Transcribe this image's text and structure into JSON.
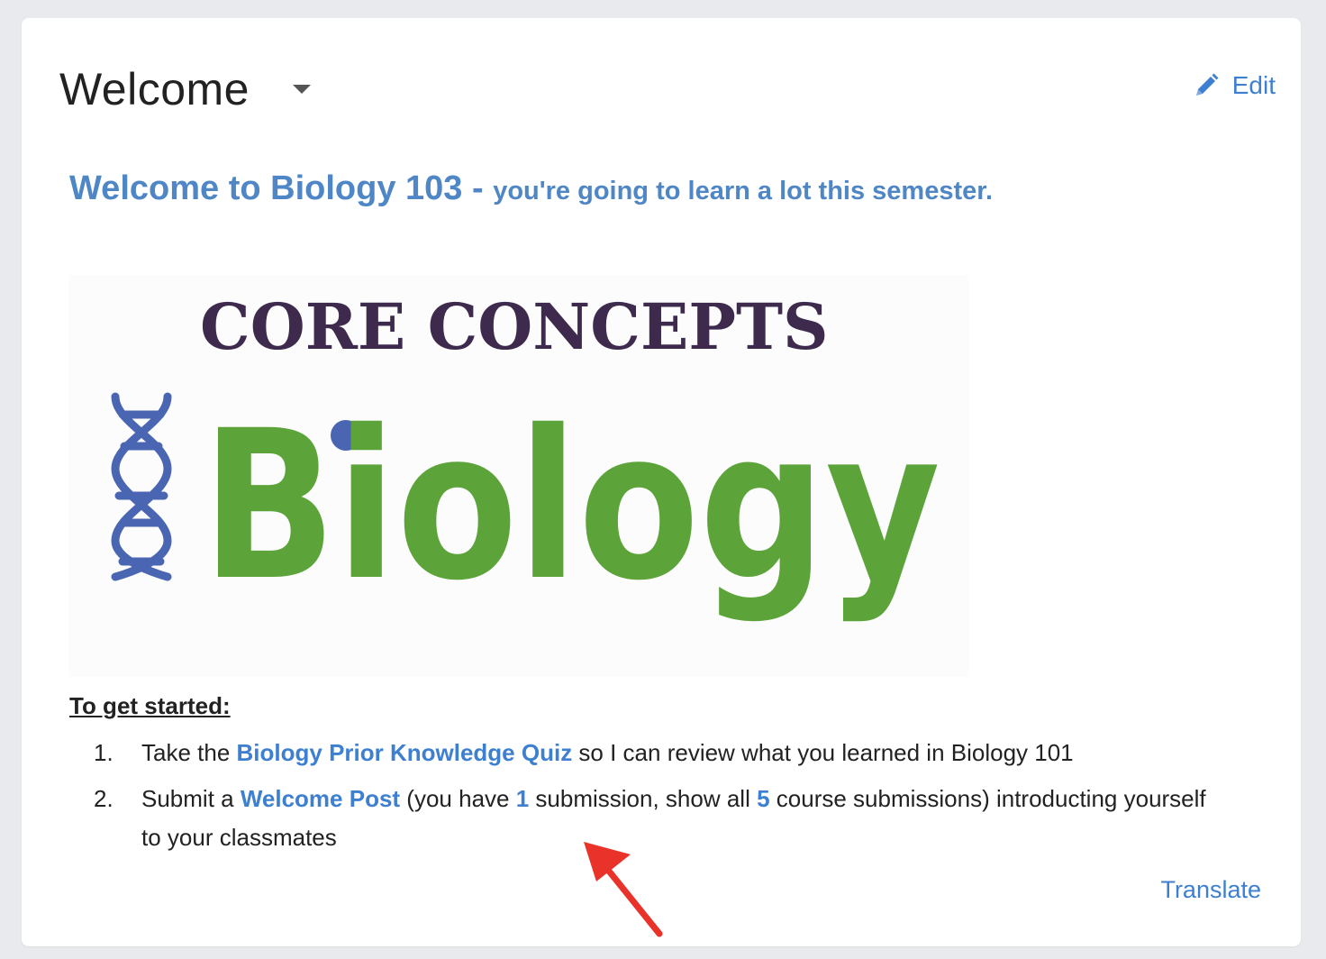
{
  "header": {
    "title": "Welcome",
    "edit_label": "Edit"
  },
  "content": {
    "headline_main": "Welcome to Biology 103 - ",
    "headline_sub": "you're going to learn a lot this semester.",
    "logo": {
      "top_text": "CORE CONCEPTS",
      "main_text": "Biology"
    },
    "getting_started": "To get started:",
    "steps": [
      {
        "num": "1.",
        "prefix": "Take the ",
        "link": "Biology Prior Knowledge Quiz",
        "suffix": " so I can review what you learned in Biology 101"
      },
      {
        "num": "2.",
        "prefix": "Submit a ",
        "link": "Welcome Post",
        "mid1": " (you have ",
        "count_link": "1",
        "mid2": " submission, show all ",
        "all_link": "5",
        "suffix": " course submissions) introducting yourself to your classmates"
      }
    ]
  },
  "footer": {
    "translate_label": "Translate"
  },
  "colors": {
    "link": "#3d7fd0",
    "headline": "#4f86c6",
    "logo_green": "#5ca43a",
    "logo_purple": "#3d2a4c",
    "logo_blue": "#4a66b3",
    "arrow": "#e8322a"
  }
}
